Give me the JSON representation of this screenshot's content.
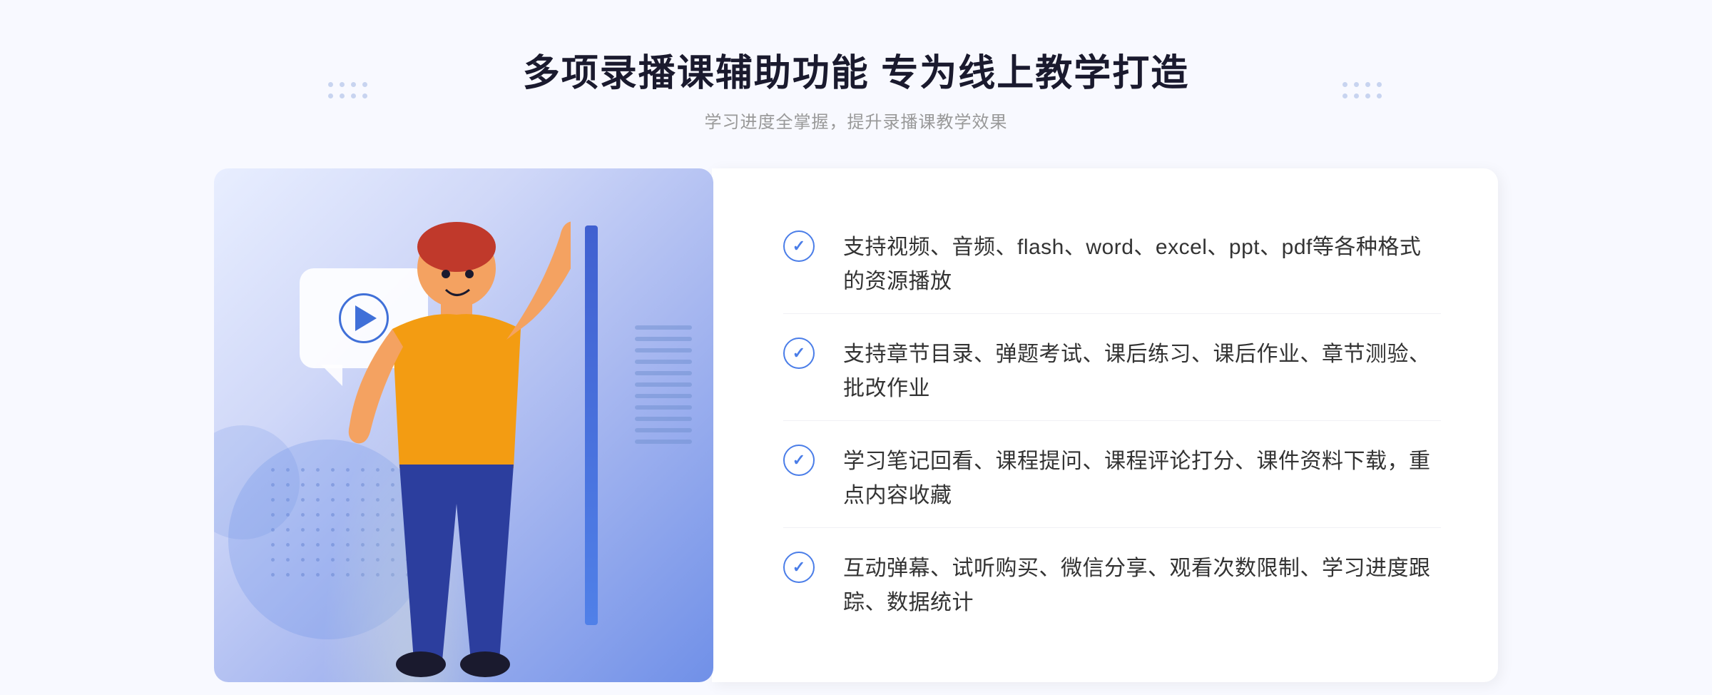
{
  "header": {
    "title": "多项录播课辅助功能 专为线上教学打造",
    "subtitle": "学习进度全掌握，提升录播课教学效果"
  },
  "features": [
    {
      "id": 1,
      "text": "支持视频、音频、flash、word、excel、ppt、pdf等各种格式的资源播放"
    },
    {
      "id": 2,
      "text": "支持章节目录、弹题考试、课后练习、课后作业、章节测验、批改作业"
    },
    {
      "id": 3,
      "text": "学习笔记回看、课程提问、课程评论打分、课件资料下载，重点内容收藏"
    },
    {
      "id": 4,
      "text": "互动弹幕、试听购买、微信分享、观看次数限制、学习进度跟踪、数据统计"
    }
  ],
  "decorations": {
    "left_chevrons": "«",
    "play_button_label": "play"
  }
}
